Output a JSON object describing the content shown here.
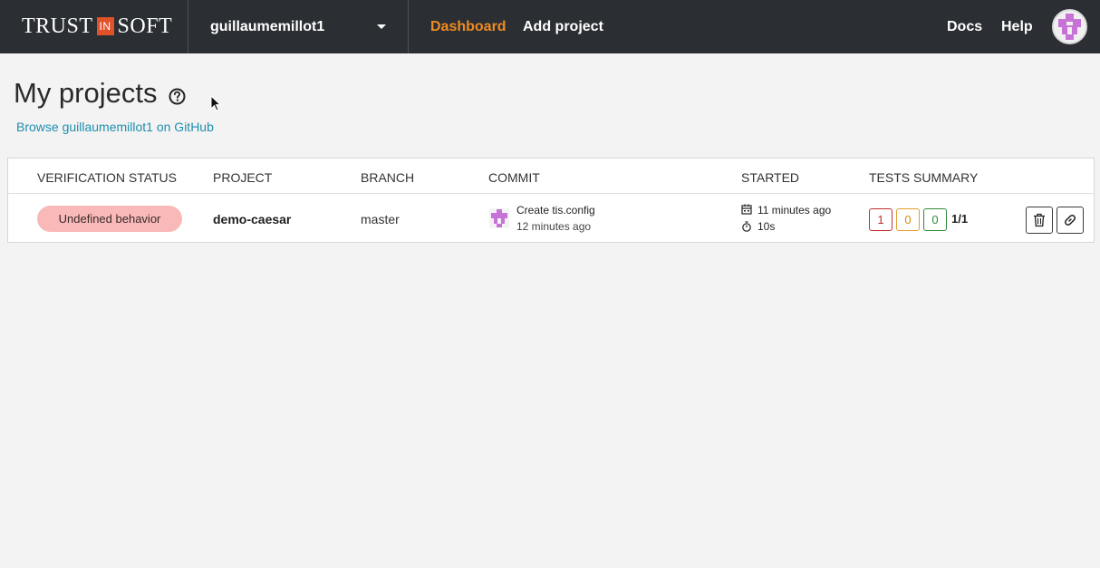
{
  "header": {
    "logo": {
      "left": "TRUST",
      "mid": "IN",
      "right": "SOFT"
    },
    "org_selector": "guillaumemillot1",
    "nav": {
      "dashboard": "Dashboard",
      "add_project": "Add project",
      "docs": "Docs",
      "help": "Help"
    },
    "avatar_icon": "user-avatar-icon"
  },
  "page": {
    "title": "My projects",
    "help_icon": "question-circle-icon",
    "github_link": "Browse guillaumemillot1 on GitHub"
  },
  "table": {
    "columns": [
      "Verification status",
      "Project",
      "Branch",
      "Commit",
      "Started",
      "Tests summary"
    ],
    "rows": [
      {
        "status": "Undefined behavior",
        "project": "demo-caesar",
        "branch": "master",
        "commit_message": "Create tis.config",
        "commit_time": "12 minutes ago",
        "started": "11 minutes ago",
        "duration": "10s",
        "tests": {
          "fail": "1",
          "warn": "0",
          "pass": "0",
          "ratio": "1/1"
        }
      }
    ]
  },
  "colors": {
    "topbar": "#2b2f33",
    "accent": "#f08a24",
    "link": "#1f8fae",
    "status_pill": "#f9b9b9",
    "fail": "#c0302c",
    "warn": "#e0a030",
    "pass": "#2e8b3a"
  }
}
